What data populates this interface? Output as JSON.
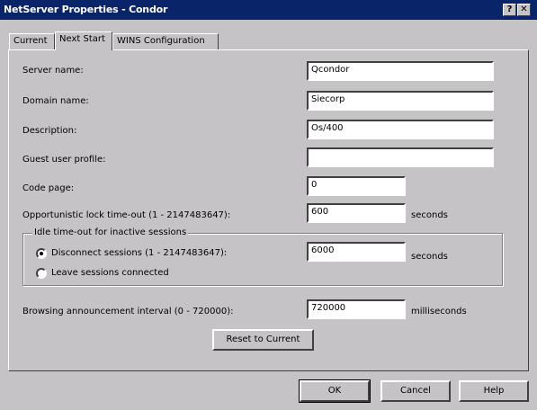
{
  "window": {
    "title": "NetServer Properties - Condor",
    "help_btn": "?",
    "close_btn": "✕"
  },
  "tabs": [
    {
      "label": "Current"
    },
    {
      "label": "Next Start"
    },
    {
      "label": "WINS Configuration"
    }
  ],
  "fields": {
    "server_name": {
      "label": "Server name:",
      "value": "Qcondor"
    },
    "domain_name": {
      "label": "Domain name:",
      "value": "Siecorp"
    },
    "description": {
      "label": "Description:",
      "value": "Os/400"
    },
    "guest_profile": {
      "label": "Guest user profile:",
      "value": ""
    },
    "code_page": {
      "label": "Code page:",
      "value": "0"
    },
    "oplock_timeout": {
      "label": "Opportunistic lock time-out (1 - 2147483647):",
      "value": "600",
      "unit": "seconds"
    },
    "browsing_interval": {
      "label": "Browsing announcement interval (0 - 720000):",
      "value": "720000",
      "unit": "milliseconds"
    }
  },
  "idle_group": {
    "legend": "Idle time-out for inactive sessions",
    "disconnect_label": "Disconnect sessions (1 - 2147483647):",
    "disconnect_value": "6000",
    "disconnect_unit": "seconds",
    "leave_label": "Leave sessions connected",
    "selected": "disconnect"
  },
  "buttons": {
    "reset": "Reset to Current",
    "ok": "OK",
    "cancel": "Cancel",
    "help": "Help"
  }
}
